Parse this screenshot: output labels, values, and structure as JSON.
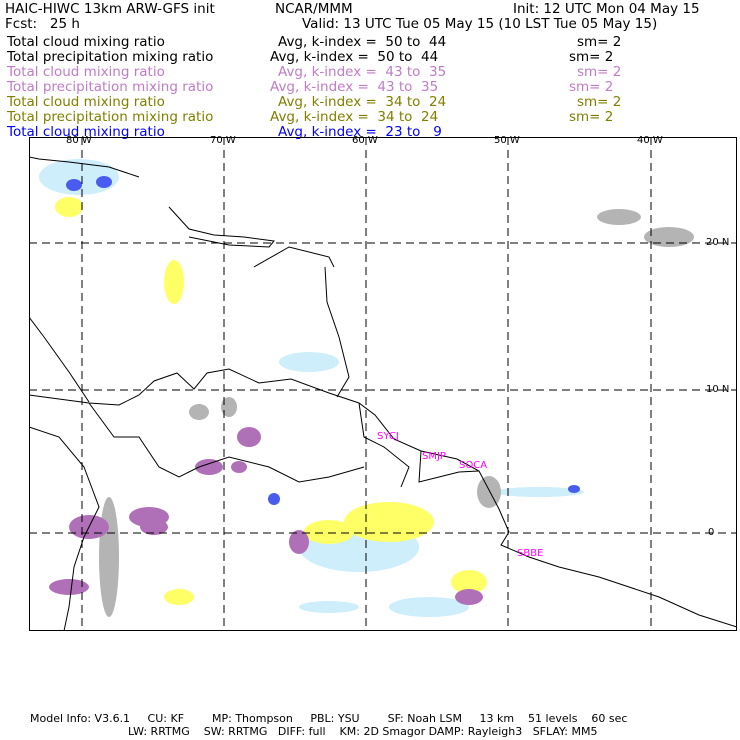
{
  "header": {
    "title": "HAIC-HIWC 13km ARW-GFS init",
    "org": "NCAR/MMM",
    "init": "Init: 12 UTC Mon 04 May 15",
    "fcst": "Fcst:   25 h",
    "valid": "Valid: 13 UTC Tue 05 May 15 (10 LST Tue 05 May 15)"
  },
  "legend": [
    {
      "field": "Total cloud mixing ratio",
      "range": "Avg, k-index =  50 to  44",
      "sm": "sm= 2",
      "color": "#000000"
    },
    {
      "field": "Total precipitation mixing ratio",
      "range": "Avg, k-index =  50 to  44",
      "sm": "sm= 2",
      "color": "#000000"
    },
    {
      "field": "Total cloud mixing ratio",
      "range": "Avg, k-index =  43 to  35",
      "sm": "sm= 2",
      "color": "#c07cc8"
    },
    {
      "field": "Total precipitation mixing ratio",
      "range": "Avg, k-index =  43 to  35",
      "sm": "sm= 2",
      "color": "#c07cc8"
    },
    {
      "field": "Total cloud mixing ratio",
      "range": "Avg, k-index =  34 to  24",
      "sm": "sm= 2",
      "color": "#808000"
    },
    {
      "field": "Total precipitation mixing ratio",
      "range": "Avg, k-index =  34 to  24",
      "sm": "sm= 2",
      "color": "#808000"
    },
    {
      "field": "Total cloud mixing ratio",
      "range": "Avg, k-index =  23 to   9",
      "sm": "",
      "color": "#0000ff"
    }
  ],
  "map": {
    "lon_labels": [
      "80 W",
      "70 W",
      "60 W",
      "50 W",
      "40 W"
    ],
    "lat_labels": [
      "20 N",
      "10 N",
      "0"
    ],
    "stations": [
      "SYCJ",
      "SMJP",
      "SOCA",
      "SBBE"
    ],
    "station_color": "#ff00ff"
  },
  "footer": {
    "line1": "Model Info: V3.6.1     CU: KF        MP: Thompson     PBL: YSU        SF: Noah LSM     13 km    51 levels    60 sec",
    "line2": "LW: RRTMG    SW: RRTMG   DIFF: full    KM: 2D Smagor DAMP: Rayleigh3   SFLAY: MM5"
  }
}
